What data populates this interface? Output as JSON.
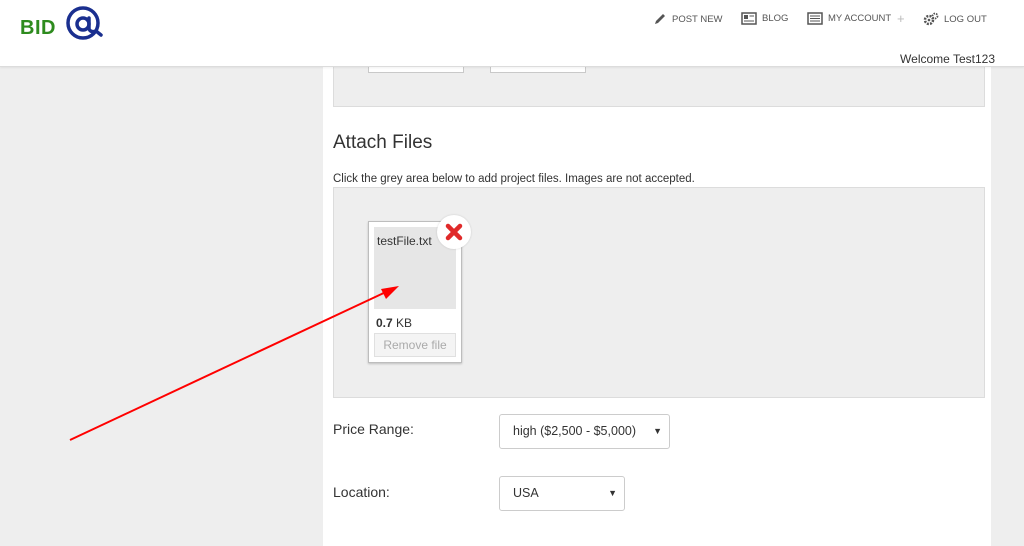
{
  "header": {
    "logo_text": "BID",
    "logo_mark": "@",
    "nav": [
      {
        "label": "POST NEW",
        "icon": "pencil-icon"
      },
      {
        "label": "BLOG",
        "icon": "newspaper-icon"
      },
      {
        "label": "MY ACCOUNT",
        "icon": "list-icon"
      },
      {
        "label": "LOG OUT",
        "icon": "gears-icon"
      }
    ],
    "plus": "+",
    "welcome": "Welcome Test123"
  },
  "attach": {
    "title": "Attach Files",
    "helper": "Click the grey area below to add project files. Images are not accepted.",
    "file": {
      "name": "testFile.txt",
      "size_value": "0.7",
      "size_unit": "KB",
      "remove_label": "Remove file"
    }
  },
  "price": {
    "label": "Price Range:",
    "selected": "high ($2,500 - $5,000)"
  },
  "location": {
    "label": "Location:",
    "selected": "USA"
  },
  "colors": {
    "logo_green": "#2e8b1e",
    "logo_blue": "#1a2f8f",
    "remove_red": "#e02a2a",
    "arrow_red": "#ff0000"
  }
}
